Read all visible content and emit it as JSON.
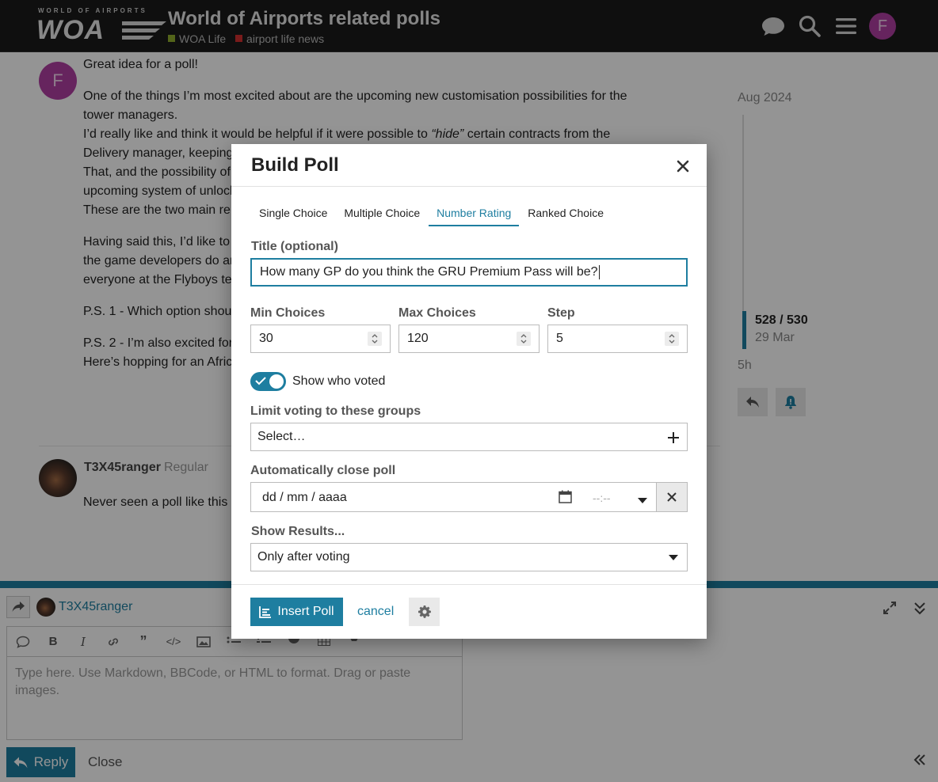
{
  "header": {
    "logo_tagline": "WORLD OF AIRPORTS",
    "logo_mark": "WOA",
    "topic_title": "World of Airports related polls",
    "categories": [
      {
        "label": "WOA Life",
        "color": "#8fad2e"
      },
      {
        "label": "airport life news",
        "color": "#d32f2f"
      }
    ],
    "user_avatar_letter": "F"
  },
  "post": {
    "avatar_letter": "F",
    "paragraphs": {
      "p1": "Great idea for a poll!",
      "p2_line1": "One of the things I’m most excited about are the upcoming new customisation possibilities for the",
      "p2_line2": "tower managers.",
      "p2_line3_a": "I’d really like and think it would be helpful if it were possible to ",
      "p2_line3_em": "“hide”",
      "p2_line3_b": " certain contracts from the",
      "p2_line4": "Delivery manager, keeping",
      "p2_line5": "That, and the possibility of",
      "p2_line6": "upcoming system of unlock",
      "p2_line7": "These are the two main re",
      "p3_line1": "Having said this, I’d like to",
      "p3_line2": "the game developers do ar",
      "p3_line3": "everyone at the Flyboys te",
      "p4": "P.S. 1 - Which option shou",
      "p5_line1": "P.S. 2 - I’m also excited for",
      "p5_line2": "Here’s hopping for an Afric"
    }
  },
  "timeline": {
    "top_date": "Aug 2024",
    "position": "528 / 530",
    "position_date": "29 Mar",
    "bottom_label": "5h"
  },
  "reply_post": {
    "username": "T3X45ranger",
    "title": "Regular",
    "text": "Never seen a poll like this"
  },
  "composer": {
    "username": "T3X45ranger",
    "placeholder": "Type here. Use Markdown, BBCode, or HTML to format. Drag or paste images.",
    "reply_label": "Reply",
    "close_label": "Close"
  },
  "modal": {
    "title": "Build Poll",
    "tabs": [
      {
        "label": "Single Choice",
        "active": false
      },
      {
        "label": "Multiple Choice",
        "active": false
      },
      {
        "label": "Number Rating",
        "active": true
      },
      {
        "label": "Ranked Choice",
        "active": false
      }
    ],
    "title_label": "Title (optional)",
    "title_value": "How many GP do you think the GRU Premium Pass will be?",
    "min_label": "Min Choices",
    "min_value": "30",
    "max_label": "Max Choices",
    "max_value": "120",
    "step_label": "Step",
    "step_value": "5",
    "show_voters_label": "Show who voted",
    "show_voters_on": true,
    "groups_label": "Limit voting to these groups",
    "groups_placeholder": "Select…",
    "autoclose_label": "Automatically close poll",
    "date_placeholder": "dd / mm / aaaa",
    "time_placeholder": "--:--",
    "results_label": "Show Results...",
    "results_value": "Only after voting",
    "insert_label": "Insert Poll",
    "cancel_label": "cancel"
  },
  "colors": {
    "accent": "#1e7ea0",
    "header_bg": "#1a1a1a",
    "avatar_purple": "#b03fa2"
  }
}
